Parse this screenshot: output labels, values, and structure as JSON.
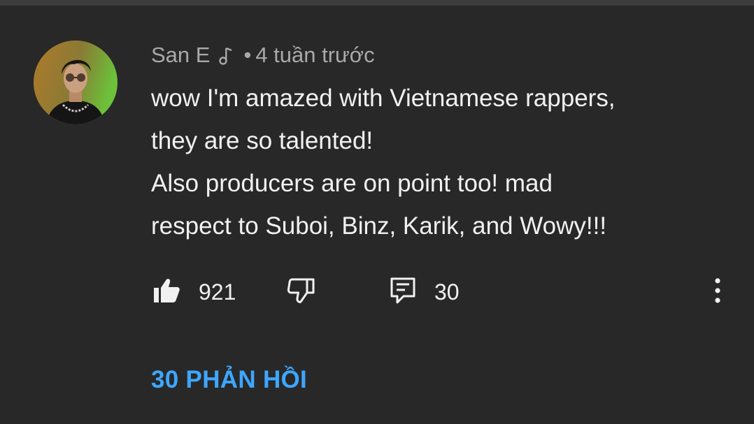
{
  "comment": {
    "author": "San E",
    "author_badge_icon": "music-note-icon",
    "separator": "•",
    "timestamp": "4 tuần trước",
    "lines": [
      "wow I'm amazed with Vietnamese rappers,",
      "they are so talented!",
      "Also producers are on point too! mad",
      "respect to Suboi, Binz, Karik, and Wowy!!!"
    ],
    "likes": "921",
    "reply_count": "30",
    "replies_link": "30 PHẢN HỒI"
  },
  "icons": {
    "like": "thumbs-up-icon",
    "dislike": "thumbs-down-icon",
    "reply": "reply-comment-icon",
    "more": "more-vertical-icon"
  },
  "colors": {
    "background": "#282828",
    "primary_text": "#f1f1f1",
    "secondary_text": "#a9a9a9",
    "link": "#3ea6ff"
  }
}
